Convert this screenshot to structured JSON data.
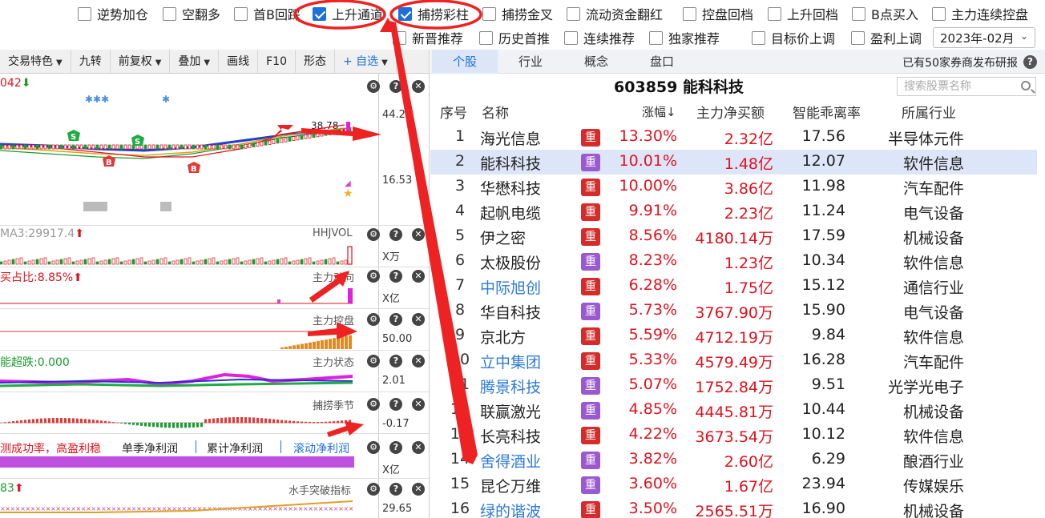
{
  "filters_row1": [
    {
      "label": "逆势加仓",
      "checked": false
    },
    {
      "label": "空翻多",
      "checked": false
    },
    {
      "label": "首B回踩",
      "checked": false
    },
    {
      "label": "上升通道",
      "checked": true
    },
    {
      "label": "捕捞彩柱",
      "checked": true
    },
    {
      "label": "捕捞金叉",
      "checked": false
    },
    {
      "label": "流动资金翻红",
      "checked": false
    },
    {
      "label": "控盘回档",
      "checked": false
    },
    {
      "label": "上升回档",
      "checked": false
    },
    {
      "label": "B点买入",
      "checked": false
    },
    {
      "label": "主力连续控盘",
      "checked": false
    }
  ],
  "filters_row2": [
    {
      "label": "新晋推荐",
      "checked": false
    },
    {
      "label": "历史首推",
      "checked": false
    },
    {
      "label": "连续推荐",
      "checked": false
    },
    {
      "label": "独家推荐",
      "checked": false
    },
    {
      "label": "目标价上调",
      "checked": false
    },
    {
      "label": "盈利上调",
      "checked": false
    }
  ],
  "month_select": "2023年-02月",
  "left_toolbar": {
    "items": [
      "交易特色",
      "九转",
      "前复权",
      "叠加",
      "画线",
      "F10",
      "形态",
      "+ 自选"
    ],
    "dropdown_flags": [
      true,
      false,
      true,
      true,
      false,
      false,
      false,
      true
    ]
  },
  "panes": {
    "main": {
      "label": "042",
      "price_high": "44.2",
      "price_label": "38.78",
      "price_low": "16.53",
      "marks_s": "S",
      "marks_b": "B"
    },
    "vol": {
      "label": "MA3:29917.4",
      "name": "HHJVOL",
      "unit": "X万"
    },
    "dir": {
      "label": "买占比:8.85%",
      "name": "主力动向",
      "unit": "X亿"
    },
    "ctrl": {
      "name": "主力控盘",
      "value": "50.00"
    },
    "state": {
      "label": "能超跌:0.000",
      "name": "主力状态",
      "value": "2.01"
    },
    "season": {
      "name": "捕捞季节",
      "value": "-0.17"
    },
    "profit": {
      "label": "测成功率，高盈利稳",
      "tab1": "单季净利润",
      "tab2": "累计净利润",
      "tab3": "滚动净利润",
      "unit": "X亿"
    },
    "breakout": {
      "label": "83",
      "name": "水手突破指标",
      "value": "29.65"
    }
  },
  "right": {
    "tabs": [
      "个股",
      "行业",
      "概念",
      "盘口"
    ],
    "active_tab": "个股",
    "broker_text": "已有50家券商发布研报",
    "stock_title": "603859  能科科技",
    "search_placeholder": "搜索股票名称",
    "headers": [
      "序号",
      "名称",
      "涨幅↓",
      "主力净买额",
      "智能乖离率",
      "所属行业"
    ],
    "badge_label": "重",
    "rows": [
      {
        "no": "1",
        "name": "海光信息",
        "name_color": "#222",
        "badge": "red",
        "chg": "13.30%",
        "net": "2.32亿",
        "bias": "17.56",
        "ind": "半导体元件"
      },
      {
        "no": "2",
        "name": "能科科技",
        "name_color": "#222",
        "badge": "purple",
        "chg": "10.01%",
        "net": "1.48亿",
        "bias": "12.07",
        "ind": "软件信息"
      },
      {
        "no": "3",
        "name": "华懋科技",
        "name_color": "#222",
        "badge": "red",
        "chg": "10.00%",
        "net": "3.86亿",
        "bias": "11.98",
        "ind": "汽车配件"
      },
      {
        "no": "4",
        "name": "起帆电缆",
        "name_color": "#222",
        "badge": "red",
        "chg": "9.91%",
        "net": "2.23亿",
        "bias": "11.24",
        "ind": "电气设备"
      },
      {
        "no": "5",
        "name": "伊之密",
        "name_color": "#222",
        "badge": "red",
        "chg": "8.56%",
        "net": "4180.14万",
        "bias": "17.59",
        "ind": "机械设备"
      },
      {
        "no": "6",
        "name": "太极股份",
        "name_color": "#222",
        "badge": "purple",
        "chg": "8.23%",
        "net": "1.23亿",
        "bias": "10.34",
        "ind": "软件信息"
      },
      {
        "no": "7",
        "name": "中际旭创",
        "name_color": "#2e7ad6",
        "badge": "red",
        "chg": "6.28%",
        "net": "1.75亿",
        "bias": "15.12",
        "ind": "通信行业"
      },
      {
        "no": "8",
        "name": "华自科技",
        "name_color": "#222",
        "badge": "purple",
        "chg": "5.73%",
        "net": "3767.90万",
        "bias": "15.90",
        "ind": "电气设备"
      },
      {
        "no": "9",
        "name": "京北方",
        "name_color": "#222",
        "badge": "red",
        "chg": "5.59%",
        "net": "4712.19万",
        "bias": "9.84",
        "ind": "软件信息"
      },
      {
        "no": "10",
        "name": "立中集团",
        "name_color": "#2e7ad6",
        "badge": "red",
        "chg": "5.33%",
        "net": "4579.49万",
        "bias": "16.28",
        "ind": "汽车配件"
      },
      {
        "no": "11",
        "name": "腾景科技",
        "name_color": "#2e7ad6",
        "badge": "purple",
        "chg": "5.07%",
        "net": "1752.84万",
        "bias": "9.51",
        "ind": "光学光电子"
      },
      {
        "no": "12",
        "name": "联赢激光",
        "name_color": "#222",
        "badge": "purple",
        "chg": "4.85%",
        "net": "4445.81万",
        "bias": "10.44",
        "ind": "机械设备"
      },
      {
        "no": "13",
        "name": "长亮科技",
        "name_color": "#222",
        "badge": "red",
        "chg": "4.22%",
        "net": "3673.54万",
        "bias": "10.12",
        "ind": "软件信息"
      },
      {
        "no": "14",
        "name": "舍得酒业",
        "name_color": "#2e7ad6",
        "badge": "purple",
        "chg": "3.82%",
        "net": "2.60亿",
        "bias": "6.29",
        "ind": "酿酒行业"
      },
      {
        "no": "15",
        "name": "昆仑万维",
        "name_color": "#222",
        "badge": "purple",
        "chg": "3.60%",
        "net": "1.67亿",
        "bias": "23.94",
        "ind": "传媒娱乐"
      },
      {
        "no": "16",
        "name": "绿的谐波",
        "name_color": "#2e7ad6",
        "badge": "red",
        "chg": "3.50%",
        "net": "2565.51万",
        "bias": "16.90",
        "ind": "机械设备"
      }
    ]
  },
  "colors": {
    "accent": "#1e6fd9",
    "red": "#e0121e",
    "badge_red": "#d42b2b",
    "badge_purple": "#9b59d0",
    "annotation": "#ee2222"
  }
}
